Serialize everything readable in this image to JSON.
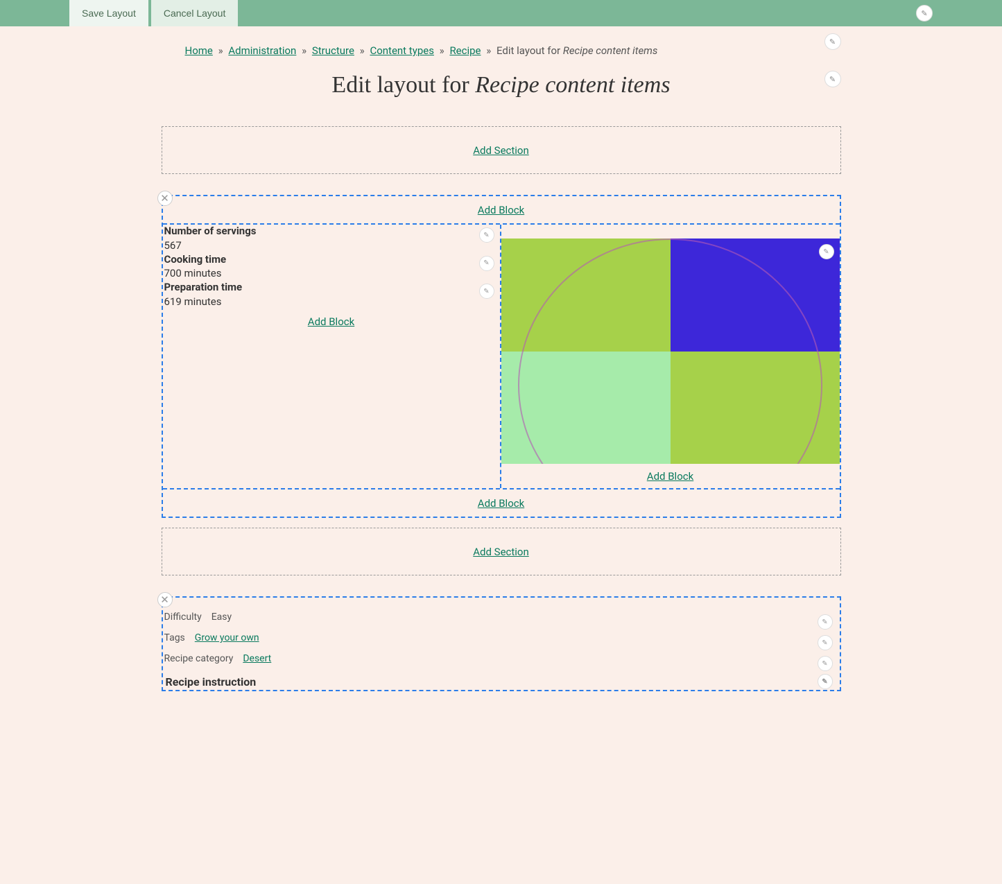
{
  "toolbar": {
    "save_label": "Save Layout",
    "cancel_label": "Cancel Layout"
  },
  "breadcrumb": {
    "home": "Home",
    "admin": "Administration",
    "structure": "Structure",
    "content_types": "Content types",
    "recipe": "Recipe",
    "current_prefix": "Edit layout for ",
    "current_italic": "Recipe content items"
  },
  "page_title": {
    "prefix": "Edit layout for ",
    "italic": "Recipe content items"
  },
  "actions": {
    "add_section": "Add Section",
    "add_block": "Add Block"
  },
  "section1": {
    "fields": [
      {
        "label": "Number of servings",
        "value": "567"
      },
      {
        "label": "Cooking time",
        "value": "700 minutes"
      },
      {
        "label": "Preparation time",
        "value": "619 minutes"
      }
    ]
  },
  "section2": {
    "difficulty_label": "Difficulty",
    "difficulty_value": "Easy",
    "tags_label": "Tags",
    "tags_value": "Grow your own",
    "category_label": "Recipe category",
    "category_value": "Desert",
    "instruction_label": "Recipe instruction"
  }
}
